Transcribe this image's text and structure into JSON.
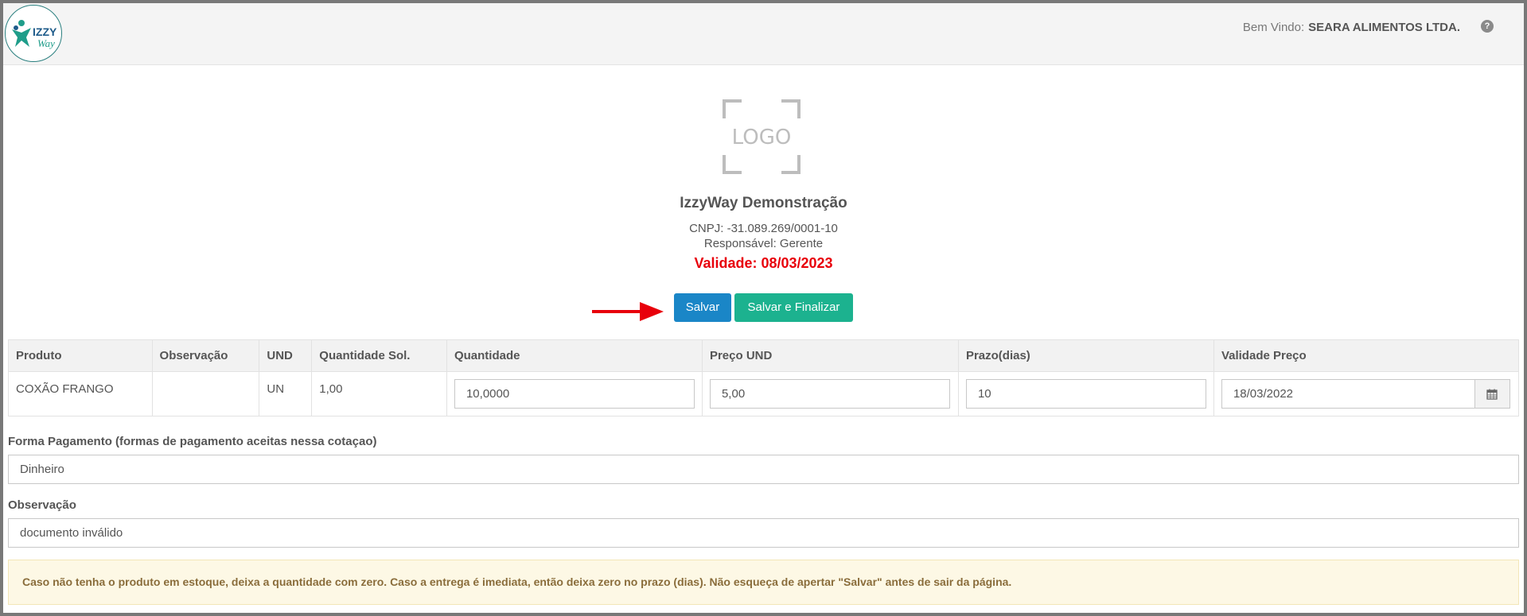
{
  "header": {
    "brand_logo_text": "IZZY Way",
    "welcome_label": "Bem Vindo:",
    "welcome_user": "SEARA ALIMENTOS LTDA.",
    "help_icon": "question-circle-icon"
  },
  "company": {
    "logo_placeholder": "LOGO",
    "name": "IzzyWay Demonstração",
    "cnpj": "CNPJ: -31.089.269/0001-10",
    "responsible": "Responsável: Gerente",
    "validity": "Validade: 08/03/2023"
  },
  "actions": {
    "save_label": "Salvar",
    "save_finish_label": "Salvar e Finalizar"
  },
  "table": {
    "headers": [
      "Produto",
      "Observação",
      "UND",
      "Quantidade Sol.",
      "Quantidade",
      "Preço UND",
      "Prazo(dias)",
      "Validade Preço"
    ],
    "row": {
      "produto": "COXÃO FRANGO",
      "observacao": "",
      "und": "UN",
      "quantidade_sol": "1,00",
      "quantidade": "10,0000",
      "preco_und": "5,00",
      "prazo": "10",
      "validade_preco": "18/03/2022"
    }
  },
  "payment": {
    "label": "Forma Pagamento (formas de pagamento aceitas nessa cotaçao)",
    "value": "Dinheiro"
  },
  "observation": {
    "label": "Observação",
    "value": "documento inválido"
  },
  "notice": "Caso não tenha o produto em estoque, deixa a quantidade com zero. Caso a entrega é imediata, então deixa zero no prazo (dias). Não esqueça de apertar \"Salvar\" antes de sair da página.",
  "colors": {
    "save_button": "#1a86c7",
    "save_finish_button": "#1cb28f",
    "validity_text": "#e8000b",
    "annotation_arrow": "#e8000b"
  }
}
